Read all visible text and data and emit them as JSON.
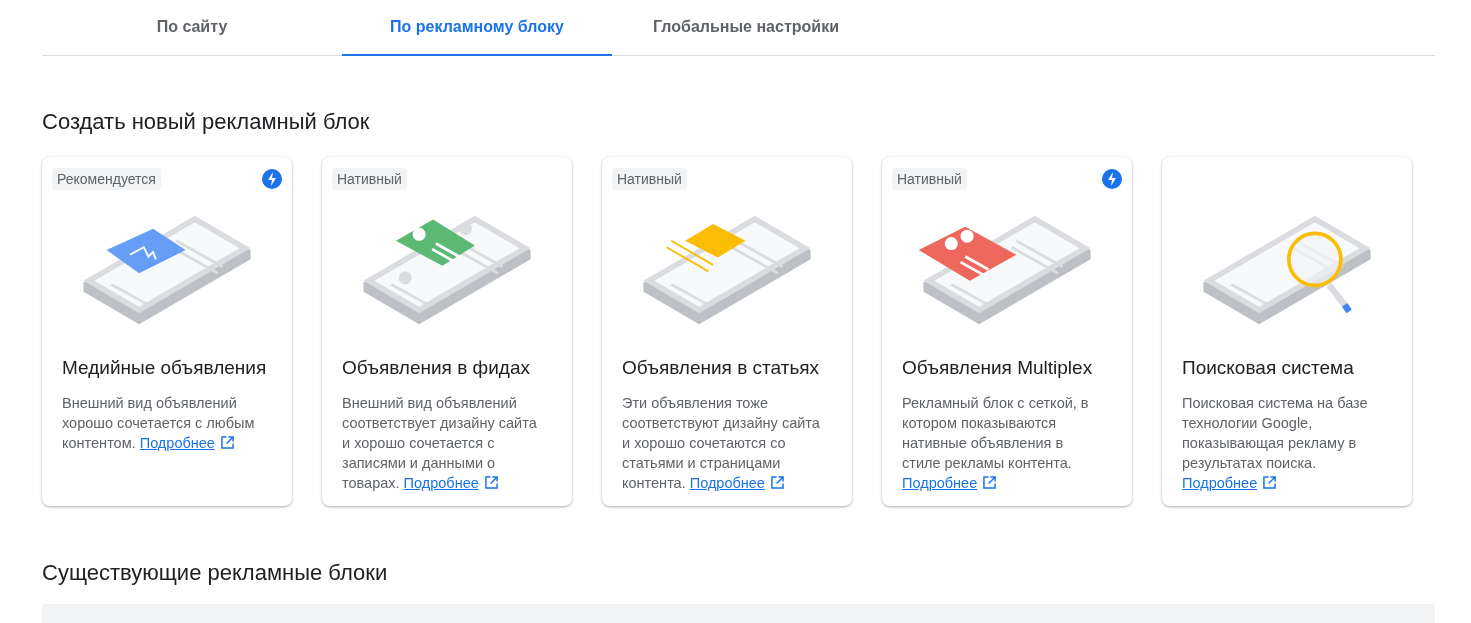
{
  "tabs": [
    {
      "label": "По сайту",
      "selected": false
    },
    {
      "label": "По рекламному блоку",
      "selected": true
    },
    {
      "label": "Глобальные настройки",
      "selected": false
    }
  ],
  "create_section": {
    "title": "Создать новый рекламный блок",
    "cards": [
      {
        "badge": "Рекомендуется",
        "fast": true,
        "kind": "display",
        "title": "Медийные объявления",
        "description": "Внешний вид объявлений хорошо сочетается с любым контентом.",
        "link": "Подробнее"
      },
      {
        "badge": "Нативный",
        "fast": false,
        "kind": "feed",
        "title": "Объявления в фидах",
        "description": "Внешний вид объявлений соответствует дизайну сайта и хорошо сочетается с записями и данными о товарах.",
        "link": "Подробнее"
      },
      {
        "badge": "Нативный",
        "fast": false,
        "kind": "article",
        "title": "Объявления в статьях",
        "description": "Эти объявления тоже соответствуют дизайну сайта и хорошо сочетаются со статьями и страницами контента.",
        "link": "Подробнее"
      },
      {
        "badge": "Нативный",
        "fast": true,
        "kind": "multiplex",
        "title": "Объявления Multiplex",
        "description": "Рекламный блок с сеткой, в котором показываются нативные объявления в стиле рекламы контента.",
        "link": "Подробнее"
      },
      {
        "fast": false,
        "kind": "search",
        "title": "Поисковая система",
        "description": "Поисковая система на базе технологии Google, показывающая рекламу в результатах поиска.",
        "link": "Подробнее"
      }
    ]
  },
  "existing_section": {
    "title": "Существующие рекламные блоки"
  }
}
